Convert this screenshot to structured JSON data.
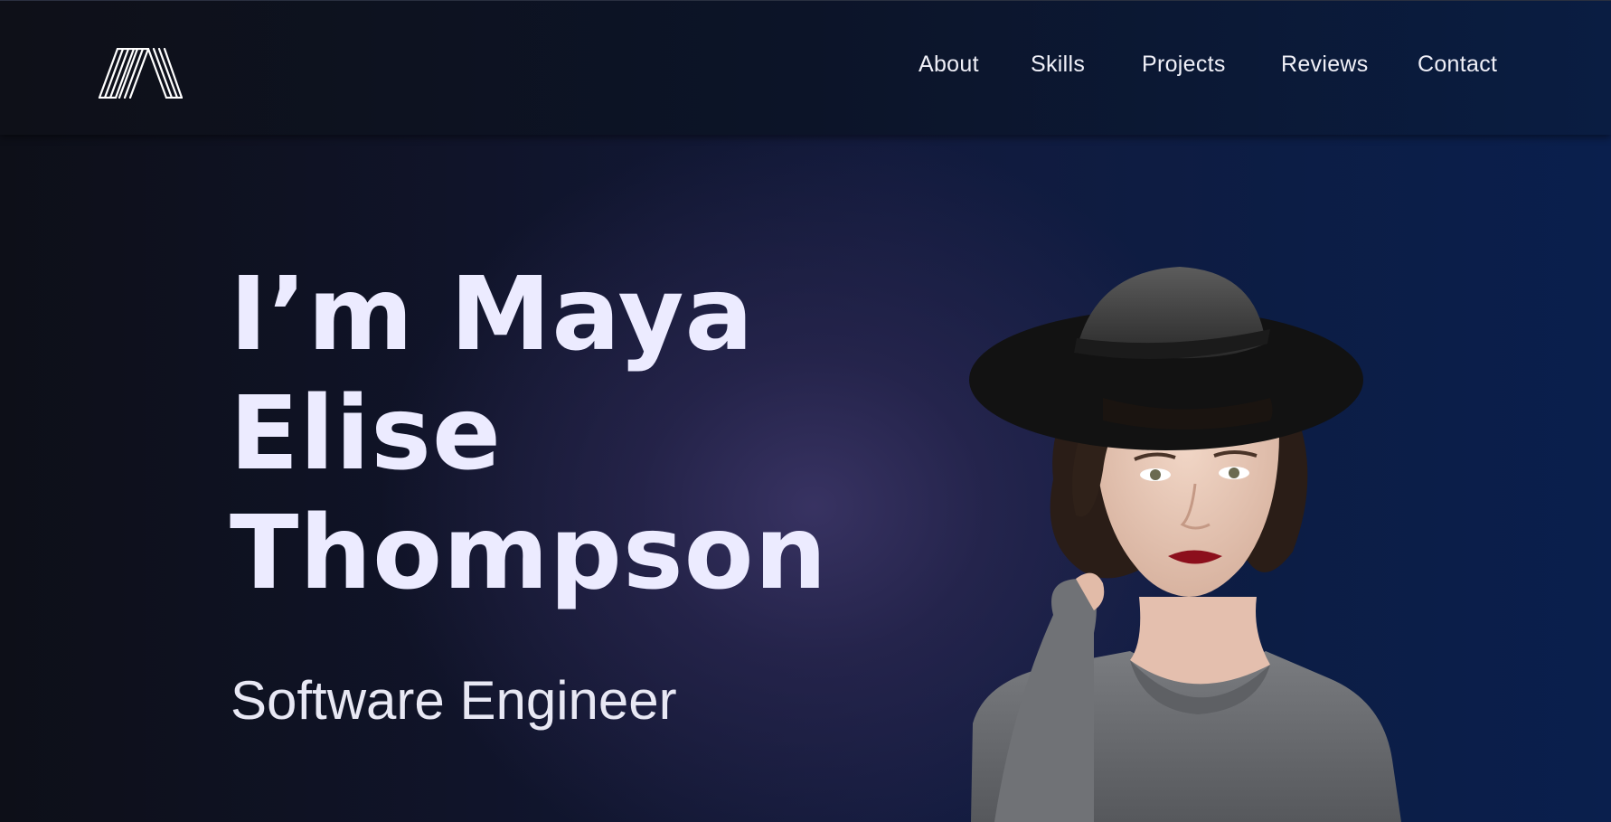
{
  "header": {
    "logo_icon": "stylized-m-logo-icon",
    "nav": [
      {
        "label": "About"
      },
      {
        "label": "Skills"
      },
      {
        "label": "Projects"
      },
      {
        "label": "Reviews"
      },
      {
        "label": "Contact"
      }
    ]
  },
  "hero": {
    "title_lines": [
      "I’m Maya",
      "Elise",
      "Thompson"
    ],
    "subtitle": "Software Engineer",
    "portrait_icon": "portrait-photo"
  },
  "colors": {
    "background_left": "#0d0f18",
    "background_right": "#0a1f4d",
    "glow": "#3a3464",
    "title_text": "#ecebff",
    "nav_text": "#f0f0f8"
  }
}
